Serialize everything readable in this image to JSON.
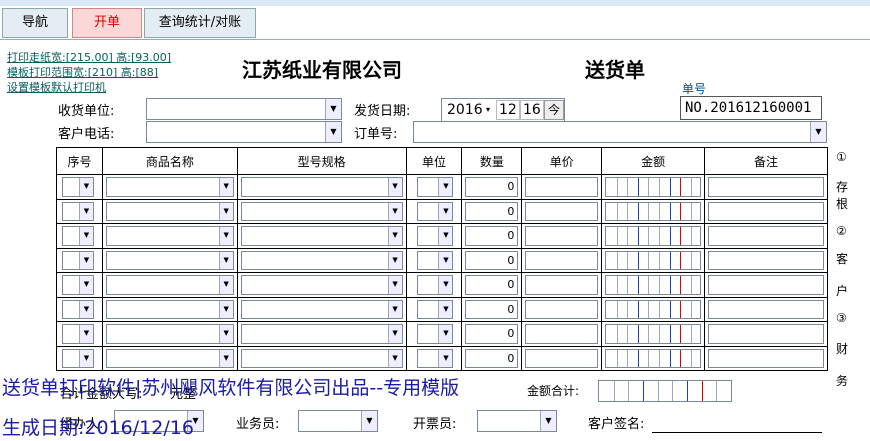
{
  "tabs": [
    {
      "label": "导航"
    },
    {
      "label": "开单"
    },
    {
      "label": "查询统计/对账"
    }
  ],
  "links": {
    "paper": "打印走纸宽:[215.00] 高:[93.00]",
    "range": "模板打印范围宽:[210] 高:[88]",
    "default_printer": "设置模板默认打印机"
  },
  "company": "江苏纸业有限公司",
  "doc_title": "送货单",
  "number": {
    "label": "单号",
    "value": "NO.201612160001"
  },
  "form": {
    "receiver_label": "收货单位:",
    "receiver_value": "",
    "phone_label": "客户电话:",
    "phone_value": "",
    "date_label": "发货日期:",
    "date_year": "2016",
    "date_month": "12",
    "date_day": "16",
    "today_label": "今",
    "order_label": "订单号:",
    "order_value": ""
  },
  "table": {
    "headers": [
      "序号",
      "商品名称",
      "型号规格",
      "单位",
      "数量",
      "单价",
      "金额",
      "备注"
    ],
    "rows": [
      {
        "qty": "0"
      },
      {
        "qty": "0"
      },
      {
        "qty": "0"
      },
      {
        "qty": "0"
      },
      {
        "qty": "0"
      },
      {
        "qty": "0"
      },
      {
        "qty": "0"
      },
      {
        "qty": "0"
      }
    ]
  },
  "side_notes": [
    "①",
    "存",
    "根",
    "②",
    "客",
    "户",
    "③",
    "财",
    "务"
  ],
  "footer": {
    "amount_caps_label": "合计金额大写:",
    "amount_caps_value": "元整",
    "total_label": "金额合计:",
    "handler_label": "经办人:",
    "salesman_label": "业务员:",
    "invoicer_label": "开票员:",
    "sign_label": "客户签名:"
  },
  "overlay": {
    "line1": "送货单打印软件|苏州飓风软件有限公司出品--专用模版",
    "line2": "生成日期:2016/12/16"
  },
  "colors": {
    "tab_active_bg": "#fcd7d7",
    "tab_active_text": "#d00000",
    "overlay": "#1a1aa6",
    "money_red": "#e00000",
    "money_blue": "#1f3fbf"
  }
}
